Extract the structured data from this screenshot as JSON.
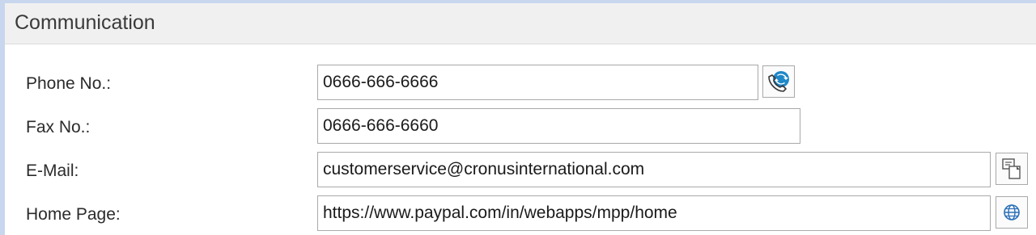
{
  "section": {
    "title": "Communication"
  },
  "fields": {
    "phone": {
      "label": "Phone No.:",
      "value": "0666-666-6666"
    },
    "fax": {
      "label": "Fax No.:",
      "value": "0666-666-6660"
    },
    "email": {
      "label": "E-Mail:",
      "value": "customerservice@cronusinternational.com"
    },
    "homepage": {
      "label": "Home Page:",
      "value": "https://www.paypal.com/in/webapps/mpp/home"
    }
  },
  "icons": {
    "phone_action": "phone-call-icon",
    "email_action": "compose-email-icon",
    "homepage_action": "globe-icon"
  },
  "colors": {
    "accent_border": "#c8d6ee",
    "header_bg": "#f0f0f0",
    "phone_icon_blue": "#1e88c8",
    "globe_icon_blue": "#2a6fb8"
  }
}
